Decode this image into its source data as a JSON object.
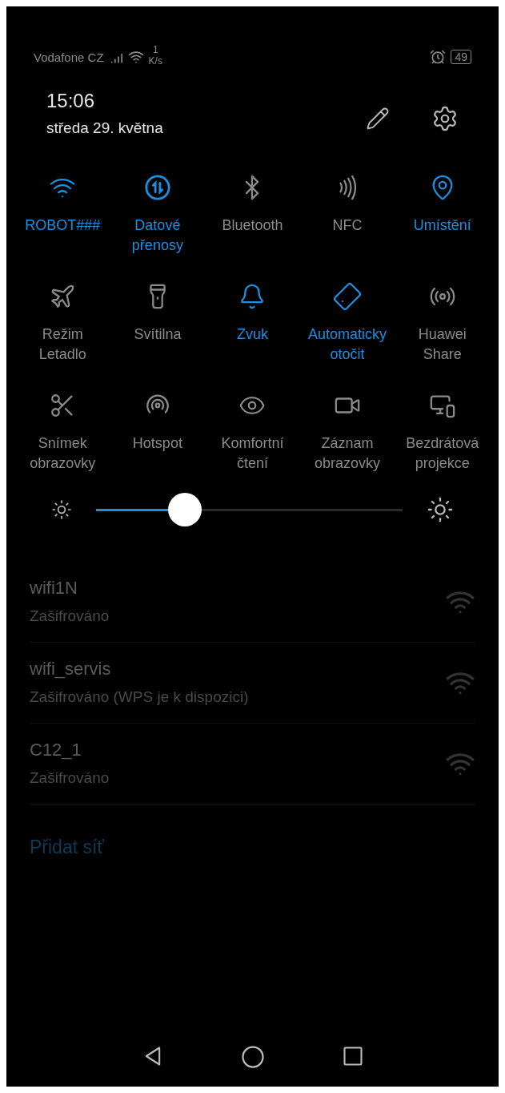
{
  "status_bar": {
    "carrier": "Vodafone CZ",
    "speed_value": "1",
    "speed_unit": "K/s",
    "battery": "49"
  },
  "panel": {
    "time": "15:06",
    "date": "středa 29. května",
    "tiles": [
      {
        "label": "ROBOT###",
        "on": true
      },
      {
        "label": "Datové přenosy",
        "on": true
      },
      {
        "label": "Bluetooth",
        "on": false
      },
      {
        "label": "NFC",
        "on": false
      },
      {
        "label": "Umístění",
        "on": true
      },
      {
        "label": "Režim Letadlo",
        "on": false
      },
      {
        "label": "Svítilna",
        "on": false
      },
      {
        "label": "Zvuk",
        "on": true
      },
      {
        "label": "Automaticky otočit",
        "on": true
      },
      {
        "label": "Huawei Share",
        "on": false
      },
      {
        "label": "Snímek obrazovky",
        "on": false
      },
      {
        "label": "Hotspot",
        "on": false
      },
      {
        "label": "Komfortní čtení",
        "on": false
      },
      {
        "label": "Záznam obrazovky",
        "on": false
      },
      {
        "label": "Bezdrátová projekce",
        "on": false
      }
    ],
    "brightness": {
      "level": 0.29
    }
  },
  "networks": [
    {
      "name": "wifi1N",
      "status": "Zašifrováno"
    },
    {
      "name": "wifi_servis",
      "status": "Zašifrováno (WPS je k dispozici)"
    },
    {
      "name": "C12_1",
      "status": "Zašifrováno"
    }
  ],
  "add_network": "Přidat síť"
}
